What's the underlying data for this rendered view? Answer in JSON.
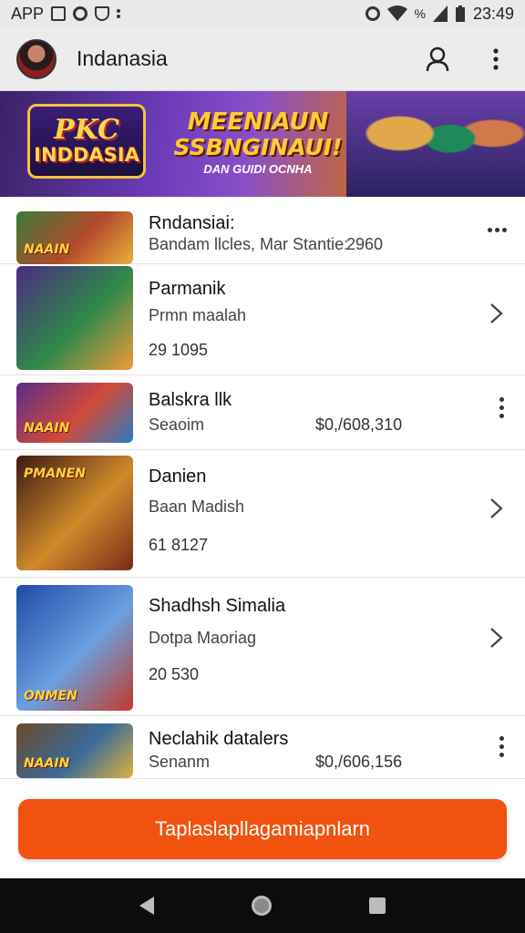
{
  "status_bar": {
    "left_label": "APP",
    "battery": "%",
    "time": "23:49",
    "icons": [
      "image-icon",
      "target-icon",
      "shield-icon",
      "more-icon",
      "alarm-icon",
      "wifi-icon",
      "signal-icon",
      "battery-icon"
    ]
  },
  "appbar": {
    "title": "Indanasia",
    "icons": [
      "avatar",
      "person-icon",
      "more-vert-icon"
    ]
  },
  "banner": {
    "logo_line1": "PKC",
    "logo_line2": "INDDASIA",
    "headline_line1": "MEENIAUN",
    "headline_line2": "SSBNGINAUI!",
    "tagline": "DAN GUIDI OCNHA"
  },
  "list": {
    "items": [
      {
        "title": "Rndansiai:",
        "subtitle": "Bandam llcles, Mar Stantie:",
        "value": "2960",
        "thumb_label": "NAAIN",
        "action": "more-horiz-icon",
        "colors": [
          "#3b7a3a",
          "#b34a2b",
          "#e8b33a"
        ]
      },
      {
        "title": "Parmanik",
        "subtitle": "Prmn maalah",
        "meta": "29 1095",
        "thumb_label": "",
        "action": "chevron-right-icon",
        "colors": [
          "#4b2a80",
          "#2e8a4a",
          "#f29a3a"
        ]
      },
      {
        "title": "Balskra llk",
        "subtitle": "Seaoim",
        "price": "$0,/608,310",
        "thumb_label": "NAAIN",
        "action": "more-vert-icon",
        "colors": [
          "#5a2d8a",
          "#d14a3a",
          "#2d7ac2"
        ]
      },
      {
        "title": "Danien",
        "subtitle": "Baan Madish",
        "meta": "61 8127",
        "thumb_label": "PMANEN",
        "action": "chevron-right-icon",
        "colors": [
          "#3a1a12",
          "#d08a2a",
          "#7a2a1a"
        ]
      },
      {
        "title": "Shadhsh Simalia",
        "subtitle": "Dotpa Maoriag",
        "meta": "20 530",
        "thumb_label": "ONMEN",
        "action": "chevron-right-icon",
        "colors": [
          "#1f4aa8",
          "#6aa0e0",
          "#c23a2a"
        ]
      },
      {
        "title": "Neclahik datalers",
        "subtitle": "Senanm",
        "price": "$0,/606,156",
        "thumb_label": "NAAIN",
        "action": "more-vert-icon",
        "colors": [
          "#6a4a2a",
          "#3a6a9a",
          "#e0b040"
        ]
      }
    ]
  },
  "cta": {
    "label": "Taplaslapllagamiapnlarn"
  },
  "nav": {
    "icons": [
      "back-icon",
      "home-icon",
      "recents-icon"
    ]
  }
}
